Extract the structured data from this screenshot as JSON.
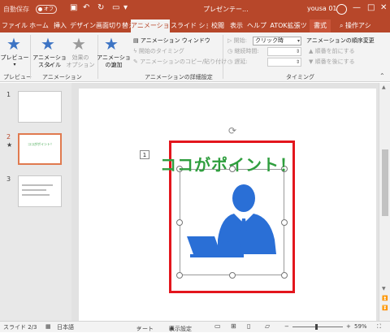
{
  "titlebar": {
    "autosave_label": "自動保存",
    "autosave_state": "オフ",
    "document_title": "プレゼンテー...",
    "user_name": "yousa 01",
    "colors": {
      "brand": "#b7472a"
    }
  },
  "tabs": [
    {
      "label": "ファイル"
    },
    {
      "label": "ホーム"
    },
    {
      "label": "挿入"
    },
    {
      "label": "デザイン"
    },
    {
      "label": "画面切り替え"
    },
    {
      "label": "アニメーション",
      "active": true
    },
    {
      "label": "スライド ショー"
    },
    {
      "label": "校閲"
    },
    {
      "label": "表示"
    },
    {
      "label": "ヘルプ"
    },
    {
      "label": "ATOK拡張ツ"
    },
    {
      "label": "書式"
    }
  ],
  "search": {
    "label": "操作アシ"
  },
  "ribbon": {
    "preview": {
      "label": "プレビュー",
      "group": "プレビュー"
    },
    "animation_style": {
      "label_line1": "アニメーション",
      "label_line2": "スタイル"
    },
    "effect_options": {
      "label_line1": "効果の",
      "label_line2": "オプション"
    },
    "animation_group": "アニメーション",
    "add_animation": {
      "label_line1": "アニメーション",
      "label_line2": "の追加"
    },
    "animation_window": "アニメーション ウィンドウ",
    "start_timing": "開始のタイミング",
    "animation_painter": "アニメーションのコピー/貼り付け",
    "advanced_group": "アニメーションの詳細設定",
    "start_label": "開始:",
    "start_value": "クリック時",
    "duration_label": "継続時間:",
    "delay_label": "遅延:",
    "timing_group": "タイミング",
    "reorder_label": "アニメーションの順序変更",
    "move_earlier": "順番を前にする",
    "move_later": "順番を後にする"
  },
  "thumbnails": [
    {
      "number": "1"
    },
    {
      "number": "2",
      "marker": "★",
      "mini_title": "ココがポイント！"
    },
    {
      "number": "3"
    }
  ],
  "slide": {
    "animation_tag": "1",
    "title": "ココがポイント！",
    "title_color": "#2f9e3e",
    "frame_color": "#e3161d",
    "icon_color": "#2a6fd6"
  },
  "status": {
    "slide_position": "スライド 2/3",
    "language": "日本語",
    "notes": "ノート",
    "display_settings": "表示設定",
    "zoom": "59%"
  }
}
